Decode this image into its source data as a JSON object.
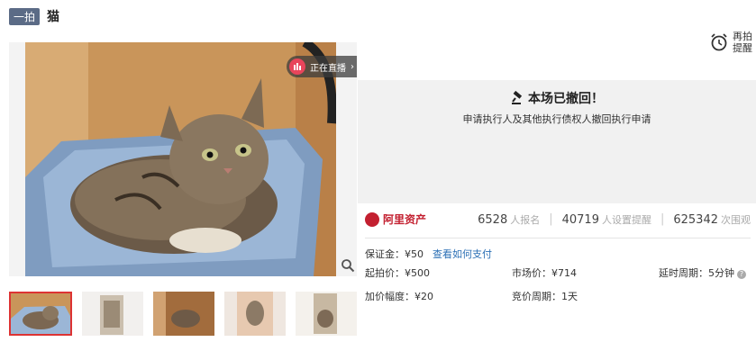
{
  "header": {
    "badge": "一拍",
    "title": "猫"
  },
  "live": {
    "label": "正在直播",
    "arrow": "›"
  },
  "reminder": {
    "line1": "再拍",
    "line2": "提醒"
  },
  "withdrawn": {
    "title": "本场已撤回！",
    "subtitle": "申请执行人及其他执行债权人撤回执行申请"
  },
  "brand": {
    "name": "阿里资产"
  },
  "stats": [
    {
      "value": "6528",
      "unit": "人报名"
    },
    {
      "value": "40719",
      "unit": "人设置提醒"
    },
    {
      "value": "625342",
      "unit": "次围观"
    }
  ],
  "deposit": {
    "label": "保证金：¥50",
    "link": "查看如何支付"
  },
  "details": {
    "start_price": "起拍价：¥500",
    "market_price": "市场价：¥714",
    "delay": "延时周期：5分钟",
    "increment": "加价幅度：¥20",
    "bid_cycle": "竞价周期：1天"
  },
  "icons": {
    "zoom": "magnifier-icon",
    "live": "live-bars-icon",
    "reminder": "alarm-clock-icon",
    "withdrawn": "gavel-icon",
    "brand": "ali-asset-logo-icon",
    "help": "question-icon"
  },
  "colors": {
    "accent": "#c32030",
    "badge": "#5b6b86",
    "link": "#2b6fb5",
    "live": "#e8455b"
  }
}
